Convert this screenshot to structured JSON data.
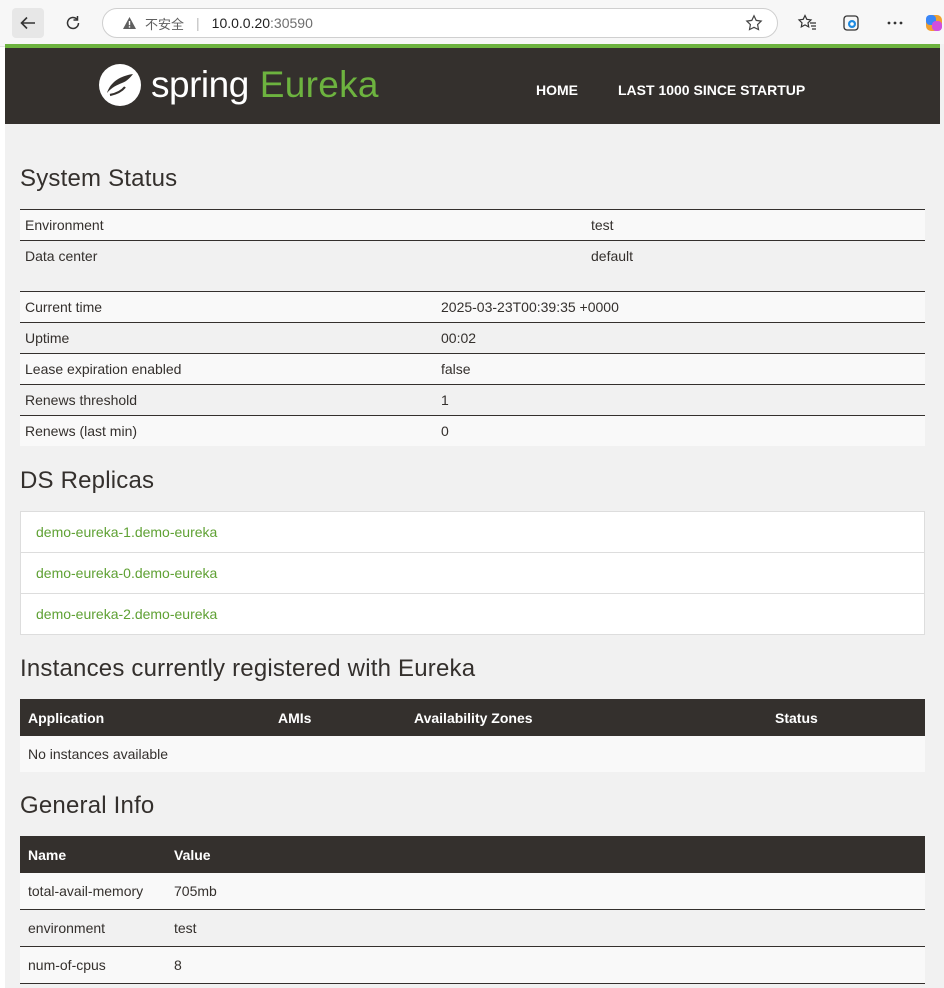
{
  "browser": {
    "address_insecure_label": "不安全",
    "address_host": "10.0.0.20",
    "address_port": ":30590"
  },
  "header": {
    "brand_spring": "spring",
    "brand_eureka": "Eureka",
    "nav": [
      {
        "label": "HOME"
      },
      {
        "label": "LAST 1000 SINCE STARTUP"
      }
    ]
  },
  "system_status": {
    "title": "System Status",
    "env_rows": [
      {
        "key": "Environment",
        "value": "test"
      },
      {
        "key": "Data center",
        "value": "default"
      }
    ],
    "stats_rows": [
      {
        "key": "Current time",
        "value": "2025-03-23T00:39:35 +0000"
      },
      {
        "key": "Uptime",
        "value": "00:02"
      },
      {
        "key": "Lease expiration enabled",
        "value": "false"
      },
      {
        "key": "Renews threshold",
        "value": "1"
      },
      {
        "key": "Renews (last min)",
        "value": "0"
      }
    ]
  },
  "ds_replicas": {
    "title": "DS Replicas",
    "items": [
      {
        "label": "demo-eureka-1.demo-eureka"
      },
      {
        "label": "demo-eureka-0.demo-eureka"
      },
      {
        "label": "demo-eureka-2.demo-eureka"
      }
    ]
  },
  "instances": {
    "title": "Instances currently registered with Eureka",
    "columns": [
      "Application",
      "AMIs",
      "Availability Zones",
      "Status"
    ],
    "empty_message": "No instances available"
  },
  "general_info": {
    "title": "General Info",
    "columns": [
      "Name",
      "Value"
    ],
    "rows": [
      {
        "name": "total-avail-memory",
        "value": "705mb"
      },
      {
        "name": "environment",
        "value": "test"
      },
      {
        "name": "num-of-cpus",
        "value": "8"
      }
    ]
  },
  "colors": {
    "brand_green": "#6db33f",
    "navbar_dark": "#34302d",
    "link_green": "#5fa134"
  }
}
